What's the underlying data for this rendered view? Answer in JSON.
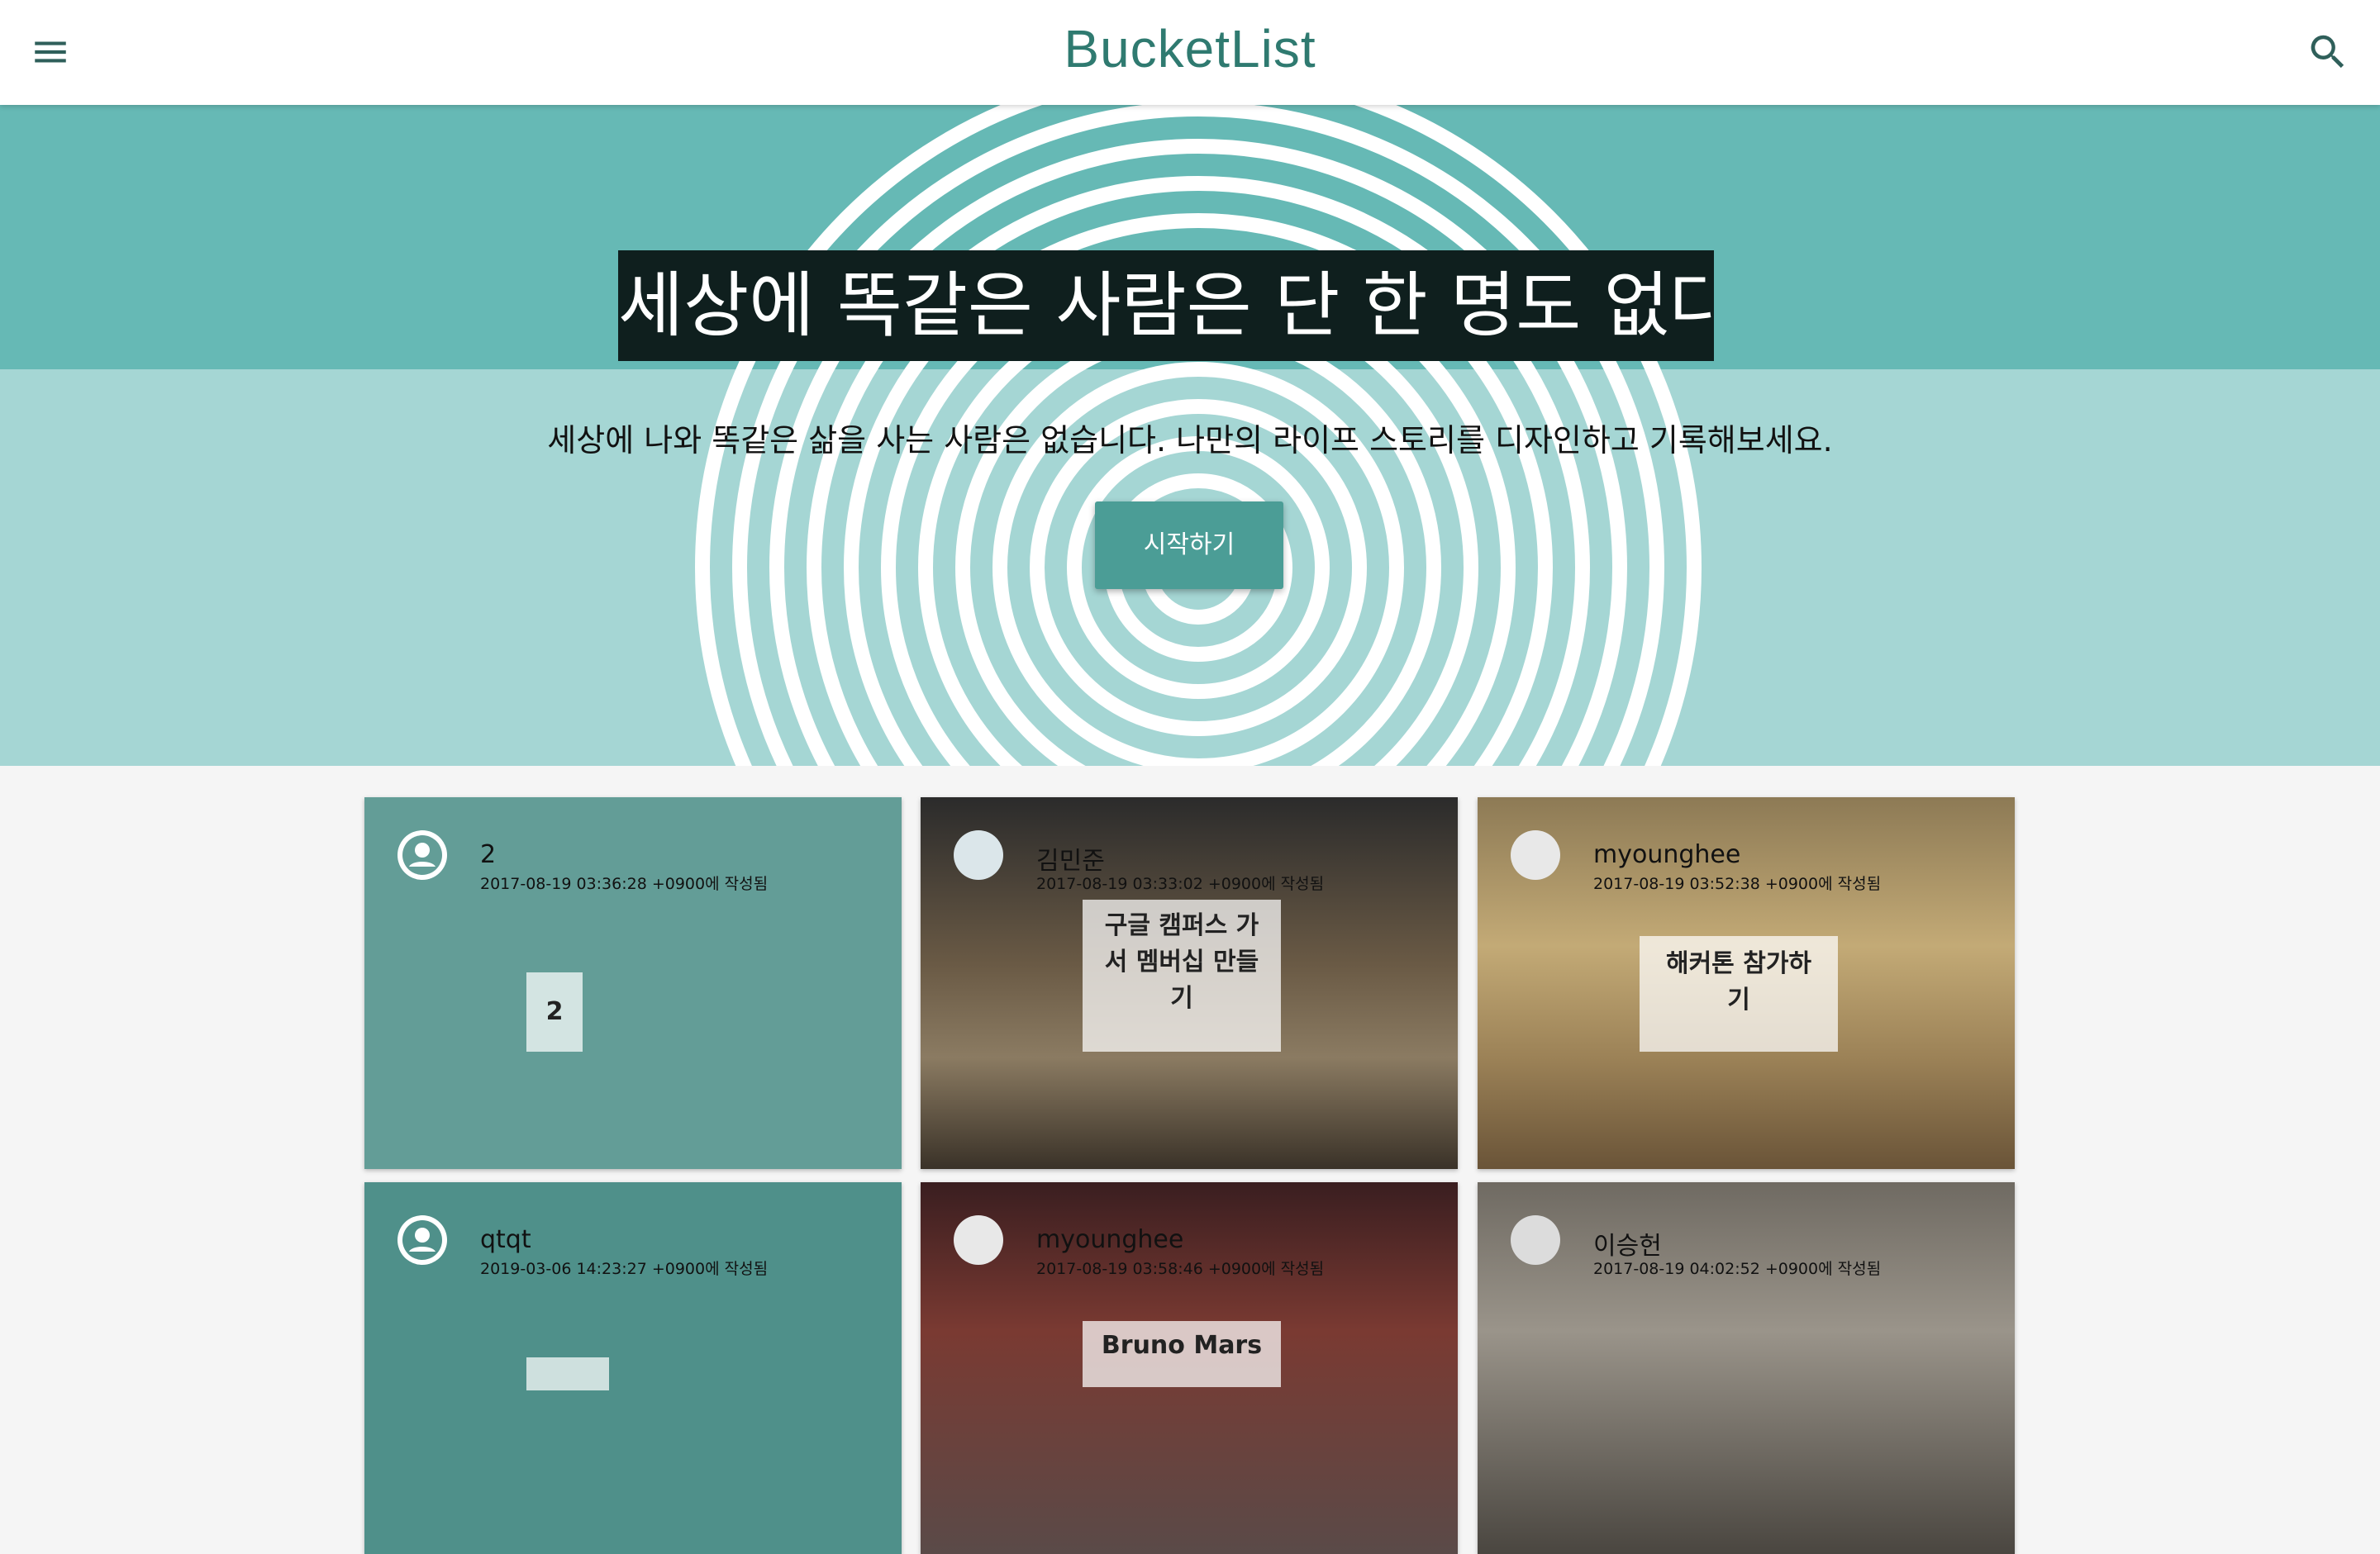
{
  "header": {
    "title": "BucketList",
    "menu_icon": "menu-icon",
    "search_icon": "search-icon"
  },
  "hero": {
    "headline": "세상에 똑같은 사람은 단 한 명도 없다.",
    "subline": "세상에 나와 똑같은 삶을 사는 사람은 없습니다. 나만의 라이프 스토리를 디자인하고 기록해보세요.",
    "cta_label": "시작하기"
  },
  "colors": {
    "accent": "#4b9d96",
    "hero_top": "#66b9b5",
    "hero_bottom": "#a5d6d4",
    "brand": "#2f7a70"
  },
  "cards": [
    {
      "author": "2",
      "date": "2017-08-19 03:36:28 +0900에 작성됨",
      "title": "2"
    },
    {
      "author": "김민준",
      "date": "2017-08-19 03:33:02 +0900에 작성됨",
      "title": "구글 캠퍼스 가\n서 멤버십 만들\n기"
    },
    {
      "author": "myounghee",
      "date": "2017-08-19 03:52:38 +0900에 작성됨",
      "title": "해커톤 참가하\n기"
    },
    {
      "author": "qtqt",
      "date": "2019-03-06 14:23:27 +0900에 작성됨",
      "title": ""
    },
    {
      "author": "myounghee",
      "date": "2017-08-19 03:58:46 +0900에 작성됨",
      "title": "Bruno Mars"
    },
    {
      "author": "이승헌",
      "date": "2017-08-19 04:02:52 +0900에 작성됨",
      "title": ""
    }
  ]
}
